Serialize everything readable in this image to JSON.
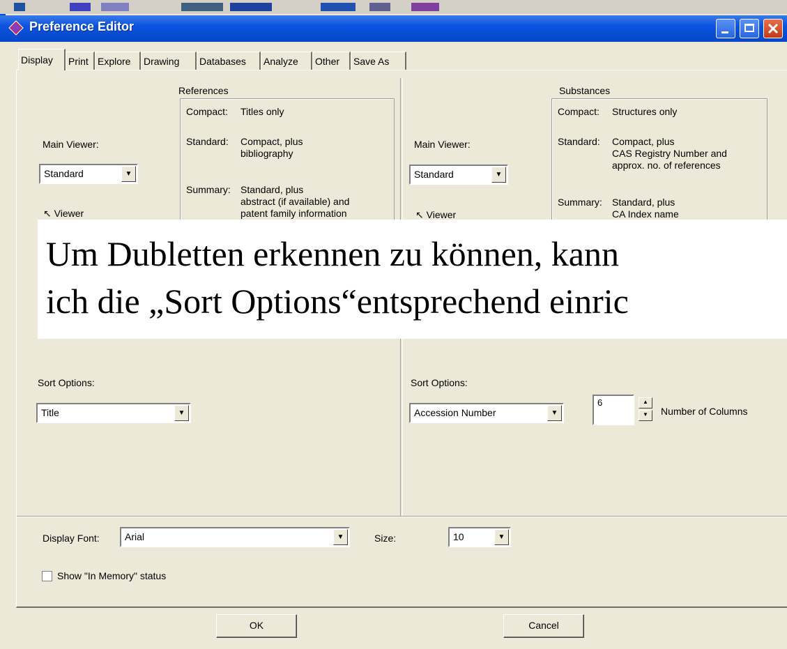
{
  "window": {
    "title": "Preference Editor",
    "minimize_icon": "minimize-icon",
    "maximize_icon": "maximize-icon",
    "close_icon": "close-icon"
  },
  "tabs": [
    "Display",
    "Print",
    "Explore",
    "Drawing",
    "Databases",
    "Analyze",
    "Other",
    "Save As"
  ],
  "references": {
    "group_title": "References",
    "main_viewer_label": "Main Viewer:",
    "main_viewer_value": "Standard",
    "rows": [
      {
        "key": "Compact:",
        "lines": [
          "Titles only"
        ]
      },
      {
        "key": "Standard:",
        "lines": [
          "Compact, plus",
          "bibliography"
        ]
      },
      {
        "key": "Summary:",
        "lines": [
          "Standard, plus",
          "abstract (if available) and",
          "patent family information"
        ]
      }
    ],
    "viewer_partial": "Viewer",
    "sort_label": "Sort Options:",
    "sort_value": "Title"
  },
  "substances": {
    "group_title": "Substances",
    "main_viewer_label": "Main Viewer:",
    "main_viewer_value": "Standard",
    "rows": [
      {
        "key": "Compact:",
        "lines": [
          "Structures only"
        ]
      },
      {
        "key": "Standard:",
        "lines": [
          "Compact, plus",
          "CAS Registry Number and",
          "approx. no. of references"
        ]
      },
      {
        "key": "Summary:",
        "lines": [
          "Standard, plus",
          "CA Index name"
        ]
      }
    ],
    "viewer_partial": "Viewer",
    "sort_label": "Sort Options:",
    "sort_value": "Accession Number",
    "columns_value": "6",
    "columns_label": "Number of Columns"
  },
  "bottom": {
    "font_label": "Display Font:",
    "font_value": "Arial",
    "size_label": "Size:",
    "size_value": "10",
    "in_memory_label": "Show \"In Memory\" status",
    "in_memory_checked": false
  },
  "buttons": {
    "ok": "OK",
    "cancel": "Cancel"
  },
  "overlay": {
    "line1": "Um Dubletten erkennen zu können, kann",
    "line2": "ich die „Sort Options“entsprechend einric"
  }
}
